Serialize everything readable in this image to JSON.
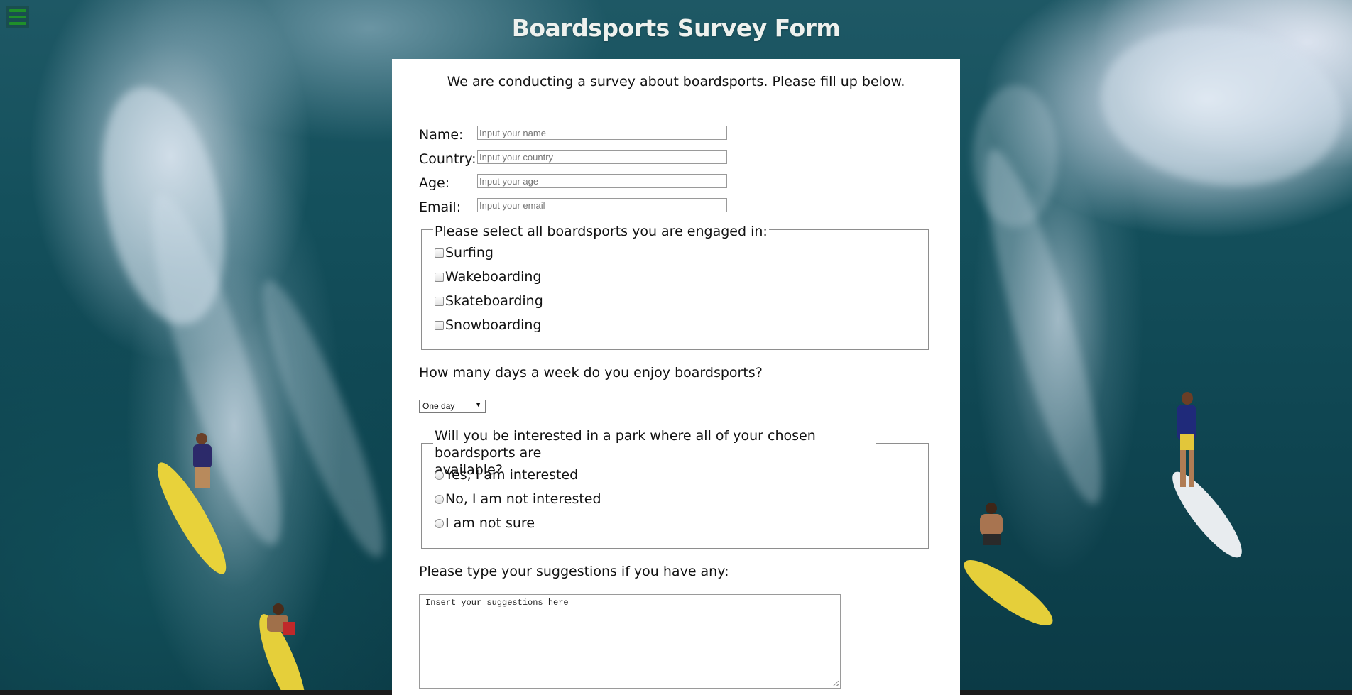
{
  "page": {
    "title": "Boardsports Survey Form",
    "intro": "We are conducting a survey about boardsports. Please fill up below."
  },
  "menu": {
    "icon": "hamburger-menu-icon",
    "color": "#1f8f2a"
  },
  "fields": [
    {
      "label": "Name:",
      "placeholder": "Input your name"
    },
    {
      "label": "Country:",
      "placeholder": "Input your country"
    },
    {
      "label": "Age:",
      "placeholder": "Input your age"
    },
    {
      "label": "Email:",
      "placeholder": "Input your email"
    }
  ],
  "sports": {
    "legend": "Please select all boardsports you are engaged in:",
    "options": [
      "Surfing",
      "Wakeboarding",
      "Skateboarding",
      "Snowboarding"
    ]
  },
  "days": {
    "question": "How many days a week do you enjoy boardsports?",
    "selected": "One day"
  },
  "park": {
    "legend_line1": "Will you be interested in a park where all of your chosen boardsports are",
    "legend_line2": "available?",
    "options": [
      "Yes, I am interested",
      "No, I am not interested",
      "I am not sure"
    ]
  },
  "suggestions": {
    "question": "Please type your suggestions if you have any:",
    "placeholder": "Insert your suggestions here"
  }
}
